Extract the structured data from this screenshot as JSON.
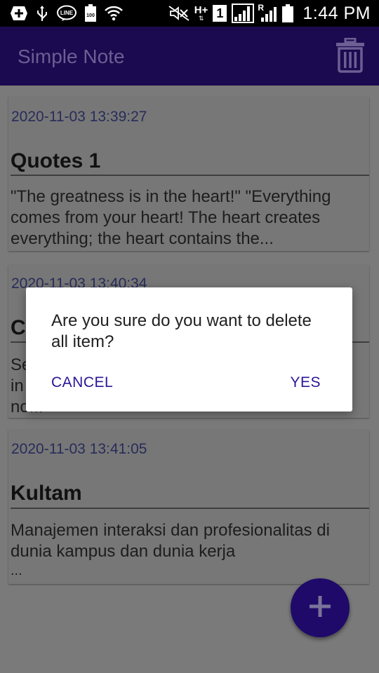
{
  "status_bar": {
    "time": "1:44 PM",
    "battery_label": "100",
    "line_label": "LINE",
    "network_label": "H+",
    "sim_label": "1",
    "roaming_label": "R",
    "icons": [
      "add-box-icon",
      "usb-icon",
      "line-app-icon",
      "battery-saver-icon",
      "wifi-icon",
      "mute-icon",
      "h-plus-icon",
      "sim-1-icon",
      "signal-icon",
      "roaming-signal-icon",
      "battery-icon"
    ]
  },
  "app_bar": {
    "title": "Simple Note",
    "delete_all_icon": "trash-icon"
  },
  "notes": [
    {
      "date": "2020-11-03 13:39:27",
      "title": "Quotes 1",
      "body": "\"The greatness is in the heart!\" \"Everything comes from your heart! The heart creates everything; the heart contains the..."
    },
    {
      "date": "2020-11-03 13:40:34",
      "title": "C",
      "body_line1": "Se",
      "body_line2": "in",
      "body_line3": "no..."
    },
    {
      "date": "2020-11-03 13:41:05",
      "title": "Kultam",
      "body": "Manajemen interaksi dan profesionalitas di dunia kampus dan dunia kerja",
      "body_tail": "..."
    }
  ],
  "fab": {
    "icon": "plus-icon"
  },
  "dialog": {
    "message": "Are you sure do you want to delete all item?",
    "cancel_label": "CANCEL",
    "yes_label": "YES"
  },
  "colors": {
    "app_bar": "#1b0a4f",
    "app_title": "#6b5f93",
    "scrim_background": "#7a7a7a",
    "date_text": "#282c5a",
    "fab": "#1f0a6a",
    "dialog_button": "#2a1696"
  }
}
